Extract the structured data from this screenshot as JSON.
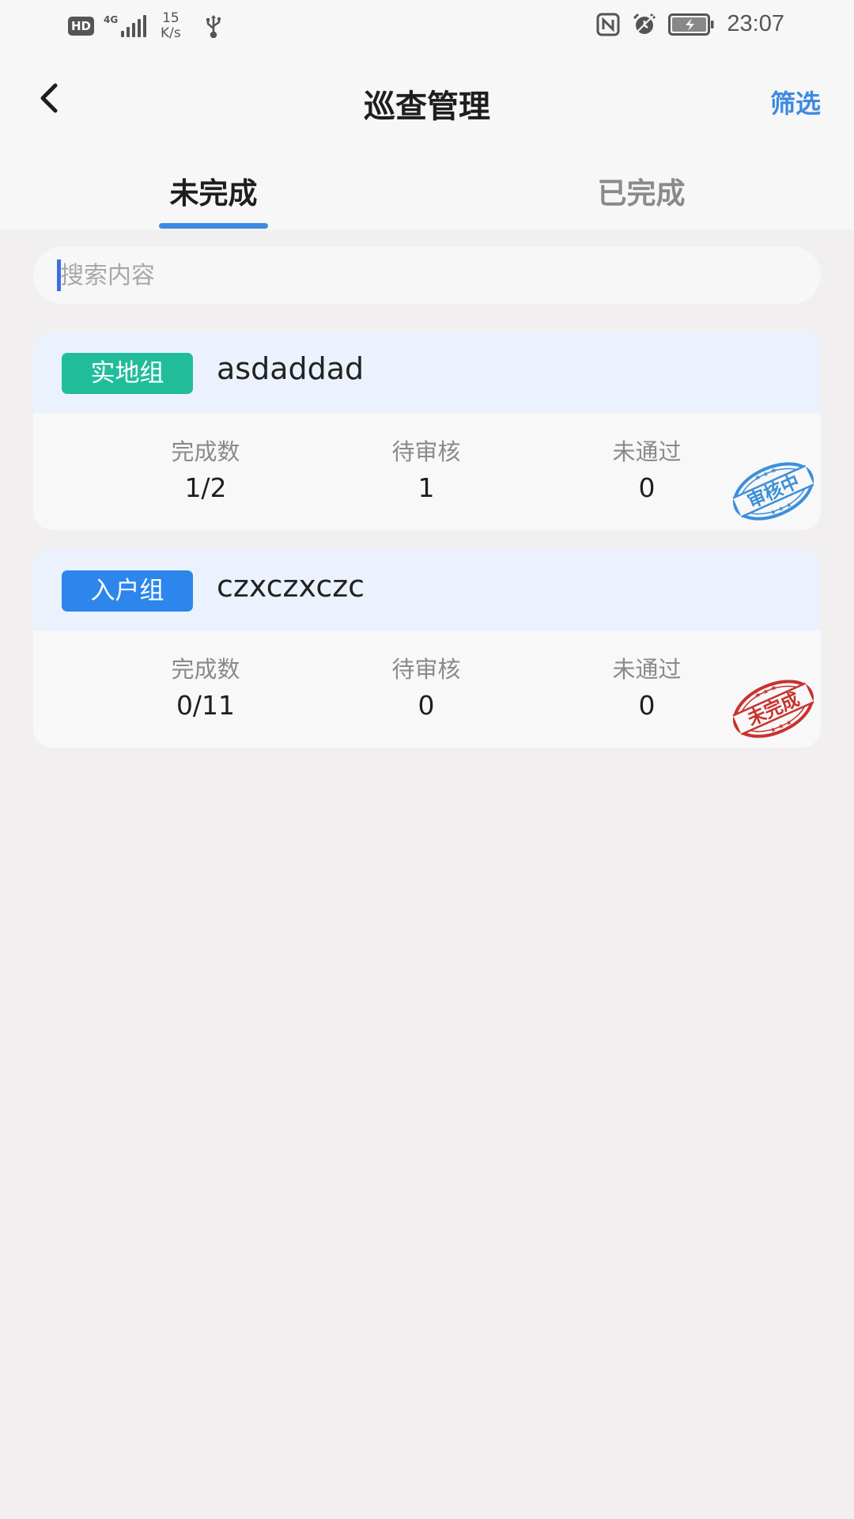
{
  "status_bar": {
    "hd": "HD",
    "network": "4G",
    "speed_value": "15",
    "speed_unit": "K/s",
    "time": "23:07",
    "icons": [
      "usb-icon",
      "nfc-icon",
      "alarm-icon",
      "battery-icon"
    ]
  },
  "nav": {
    "title": "巡查管理",
    "filter_label": "筛选",
    "back_icon": "chevron-left-icon"
  },
  "tabs": [
    {
      "label": "未完成",
      "active": true
    },
    {
      "label": "已完成",
      "active": false
    }
  ],
  "search": {
    "placeholder": "搜索内容",
    "value": ""
  },
  "cards": [
    {
      "tag": "实地组",
      "tag_color": "#21bd9b",
      "name": "asdaddad",
      "stats": [
        {
          "label": "完成数",
          "value": "1/2"
        },
        {
          "label": "待审核",
          "value": "1"
        },
        {
          "label": "未通过",
          "value": "0"
        }
      ],
      "stamp_text": "审核中",
      "stamp_color": "#3b8fd9"
    },
    {
      "tag": "入户组",
      "tag_color": "#2c86ec",
      "name": "czxczxczc",
      "stats": [
        {
          "label": "完成数",
          "value": "0/11"
        },
        {
          "label": "待审核",
          "value": "0"
        },
        {
          "label": "未通过",
          "value": "0"
        }
      ],
      "stamp_text": "未完成",
      "stamp_color": "#c8322e"
    }
  ],
  "colors": {
    "accent": "#3d8ae0",
    "background": "#f2eff0",
    "card_header": "#ecf2fd"
  }
}
